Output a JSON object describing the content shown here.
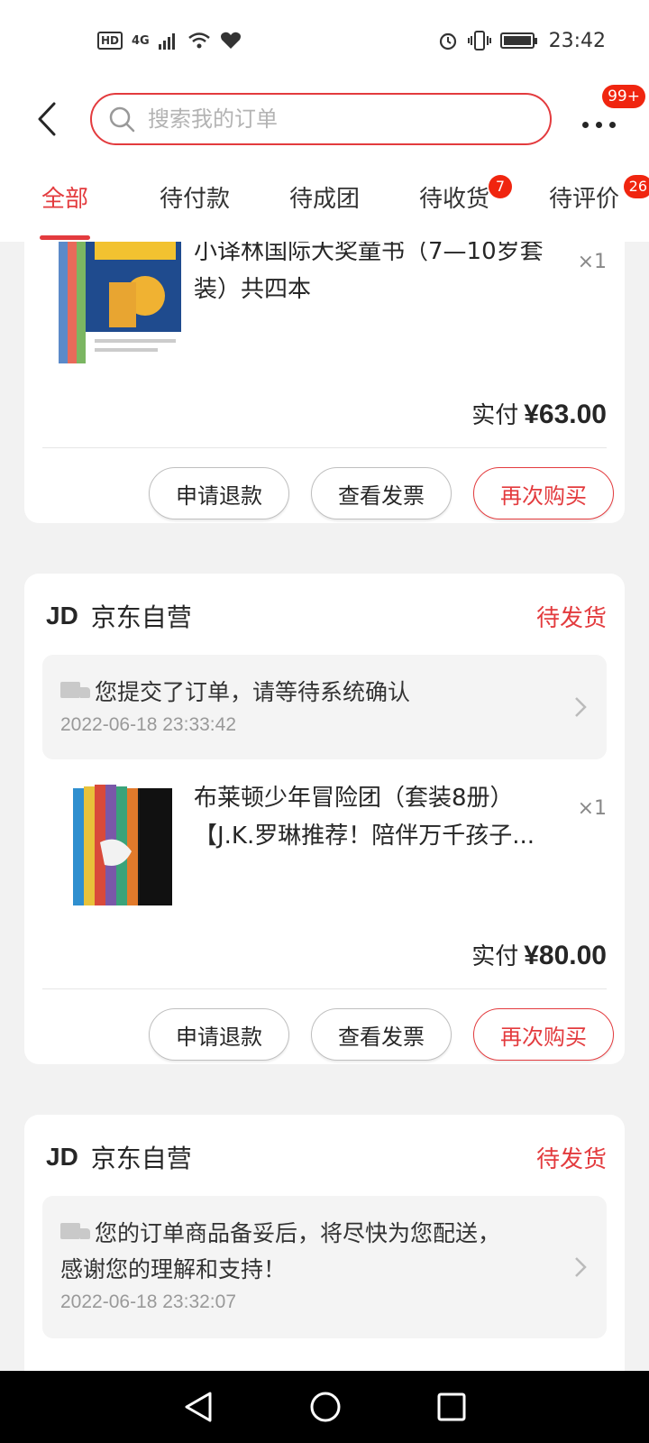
{
  "status_bar": {
    "left": [
      "HD",
      "4G"
    ],
    "time": "23:42"
  },
  "header": {
    "search_placeholder": "搜索我的订单",
    "more_badge": "99+"
  },
  "tabs": [
    {
      "label": "全部",
      "badge": ""
    },
    {
      "label": "待付款",
      "badge": ""
    },
    {
      "label": "待成团",
      "badge": ""
    },
    {
      "label": "待收货",
      "badge": "7"
    },
    {
      "label": "待评价",
      "badge": "26"
    }
  ],
  "orders": [
    {
      "title_line1": "小译林国际大奖童书（7—10岁套",
      "title_line2": "装）共四本",
      "qty": "×1",
      "paid_label": "实付",
      "paid_amount": "¥63.00",
      "actions": [
        "申请退款",
        "查看发票",
        "再次购买"
      ]
    },
    {
      "store_logo": "JD",
      "store_name": "京东自营",
      "status": "待发货",
      "track_text": "您提交了订单，请等待系统确认",
      "track_time": "2022-06-18 23:33:42",
      "title_line1": "布莱顿少年冒险团（套装8册）",
      "title_line2": "【J.K.罗琳推荐！陪伴万千孩子...",
      "qty": "×1",
      "paid_label": "实付",
      "paid_amount": "¥80.00",
      "actions": [
        "申请退款",
        "查看发票",
        "再次购买"
      ]
    },
    {
      "store_logo": "JD",
      "store_name": "京东自营",
      "status": "待发货",
      "track_text_line1": "您的订单商品备妥后，将尽快为您配送，",
      "track_text_line2": "感谢您的理解和支持！",
      "track_time": "2022-06-18 23:32:07"
    }
  ],
  "colors": {
    "accent": "#e33b3e",
    "badge": "#f0250f",
    "background": "#f2f2f2"
  },
  "icons": [
    "back-arrow-icon",
    "search-icon",
    "more-dots-icon",
    "truck-icon",
    "chevron-right-icon",
    "nav-back-icon",
    "nav-home-icon",
    "nav-recents-icon"
  ]
}
